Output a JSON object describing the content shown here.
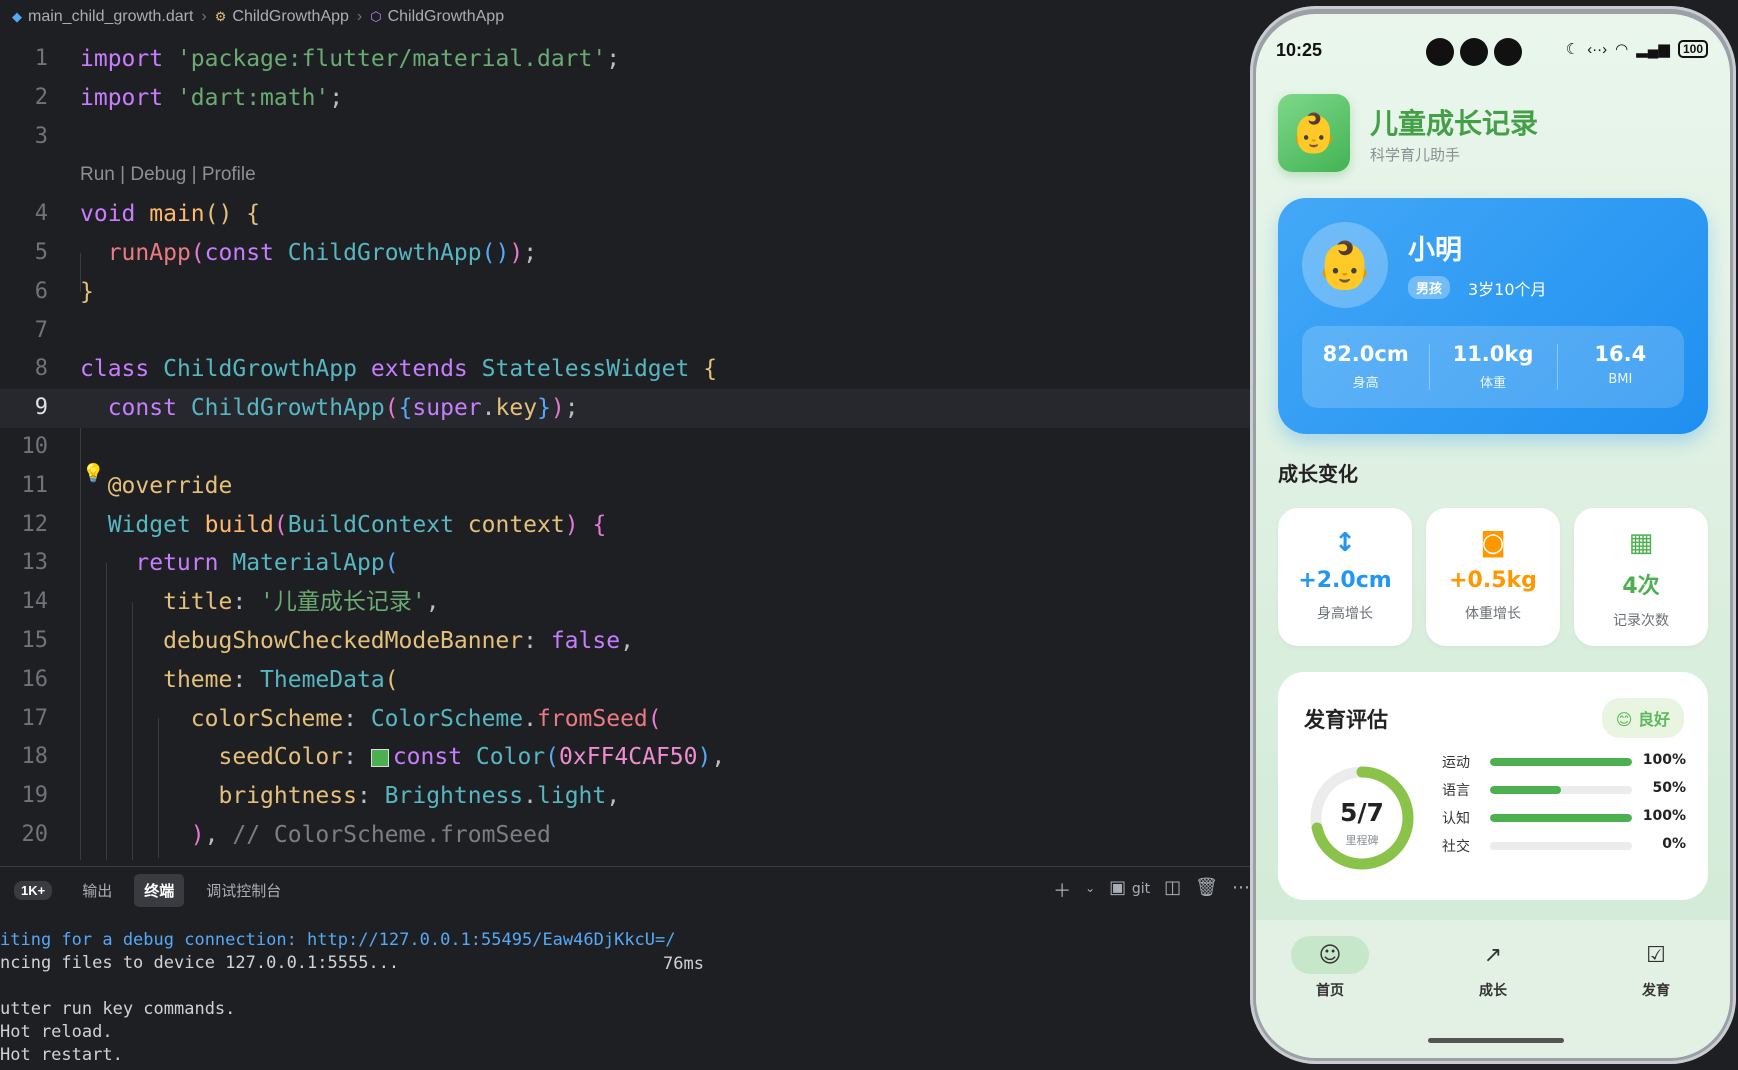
{
  "breadcrumb": [
    "main_child_growth.dart",
    "ChildGrowthApp",
    "ChildGrowthApp"
  ],
  "codelens": "Run | Debug | Profile",
  "current_line": 9,
  "panel": {
    "tab_count": "1K+",
    "tabs": [
      "输出",
      "终端",
      "调试控制台"
    ],
    "active_tab": "终端",
    "actions": [
      "+",
      "⌄",
      "git",
      "split",
      "trash",
      "more"
    ],
    "git_label": "git",
    "lines": [
      "iting for a debug connection: http://127.0.0.1:55495/Eaw46DjKkcU=/",
      "ncing files to device 127.0.0.1:5555...",
      "",
      "utter run key commands.",
      "Hot reload.",
      "Hot restart."
    ],
    "time": "76ms"
  },
  "phone": {
    "status_time": "10:25",
    "battery": "100",
    "app_title": "儿童成长记录",
    "app_subtitle": "科学育儿助手",
    "child": {
      "name": "小明",
      "gender": "男孩",
      "age": "3岁10个月",
      "metrics": [
        {
          "value": "82.0cm",
          "label": "身高"
        },
        {
          "value": "11.0kg",
          "label": "体重"
        },
        {
          "value": "16.4",
          "label": "BMI"
        }
      ]
    },
    "growth_title": "成长变化",
    "changes": [
      {
        "icon": "↕",
        "value": "+2.0cm",
        "label": "身高增长",
        "color": "#2196f3"
      },
      {
        "icon": "◙",
        "value": "+0.5kg",
        "label": "体重增长",
        "color": "#ff9800"
      },
      {
        "icon": "▦",
        "value": "4次",
        "label": "记录次数",
        "color": "#4caf50"
      }
    ],
    "dev": {
      "title": "发育评估",
      "badge": "😊 良好",
      "milestone": "5/7",
      "milestone_label": "里程碑",
      "milestone_fraction": 0.714,
      "items": [
        {
          "label": "运动",
          "pct": "100%",
          "value": 1.0
        },
        {
          "label": "语言",
          "pct": "50%",
          "value": 0.5
        },
        {
          "label": "认知",
          "pct": "100%",
          "value": 1.0
        },
        {
          "label": "社交",
          "pct": "0%",
          "value": 0.0
        }
      ]
    },
    "nav": [
      {
        "label": "首页",
        "icon": "☺"
      },
      {
        "label": "成长",
        "icon": "↗"
      },
      {
        "label": "发育",
        "icon": "☑"
      }
    ]
  }
}
